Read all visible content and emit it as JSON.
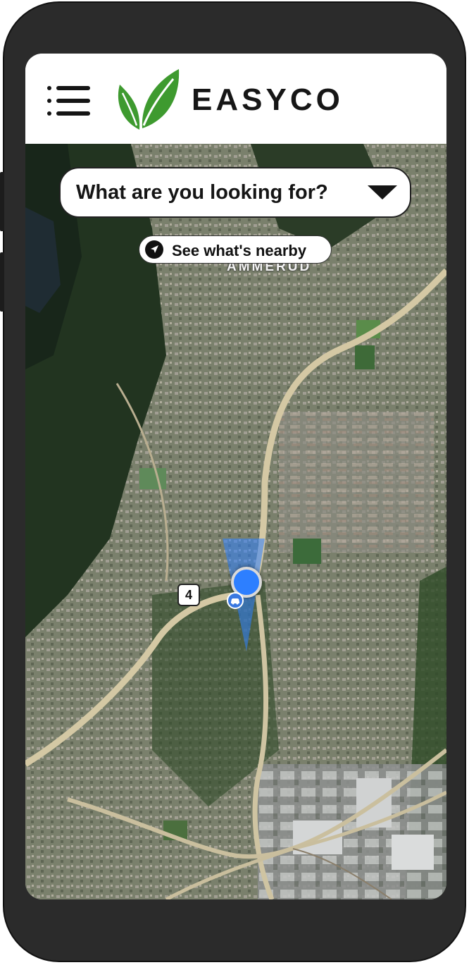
{
  "app": {
    "brand_name": "EASYCO"
  },
  "header": {
    "menu_icon": "hamburger-menu-icon",
    "logo_icon": "leaf-logo-icon",
    "logo_color": "#3e9a2f"
  },
  "search": {
    "label": "What are you looking for?",
    "icon": "caret-down-icon"
  },
  "nearby": {
    "label": "See what's nearby",
    "icon": "navigation-arrow-icon"
  },
  "map": {
    "place_label": "AMMERUD",
    "road_number": "4",
    "user_location_color": "#2d7fff",
    "car_marker_icon": "car-icon"
  }
}
